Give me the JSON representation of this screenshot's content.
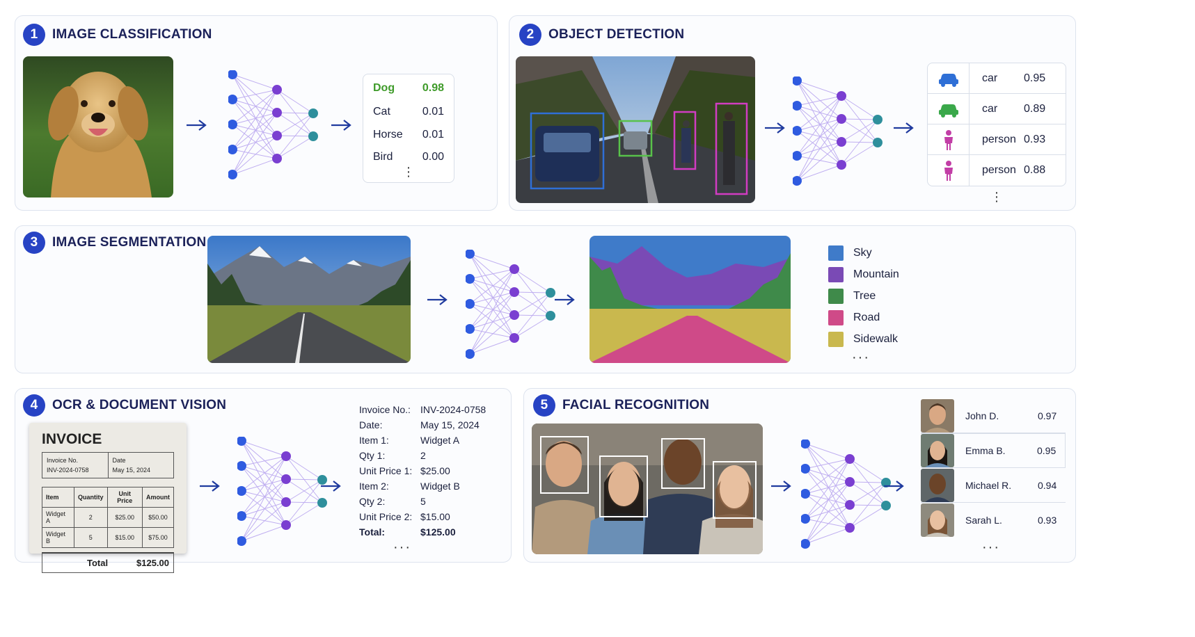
{
  "colors": {
    "accent": "#2743c4",
    "title": "#1b2159",
    "node_blue": "#2f5be0",
    "node_purple": "#7a3fd1",
    "node_teal": "#2e8f9c",
    "top_class": "#3f9b2a"
  },
  "panels": {
    "classification": {
      "number": "1",
      "title": "IMAGE CLASSIFICATION",
      "image_icon": "golden-retriever-photo",
      "results": [
        {
          "label": "Dog",
          "score": "0.98"
        },
        {
          "label": "Cat",
          "score": "0.01"
        },
        {
          "label": "Horse",
          "score": "0.01"
        },
        {
          "label": "Bird",
          "score": "0.00"
        }
      ],
      "more": "⋮"
    },
    "detection": {
      "number": "2",
      "title": "OBJECT DETECTION",
      "image_icon": "city-street-photo",
      "results": [
        {
          "icon": "car-icon",
          "icon_color": "#2f6fd6",
          "label": "car",
          "score": "0.95"
        },
        {
          "icon": "car-icon",
          "icon_color": "#3aa84a",
          "label": "car",
          "score": "0.89"
        },
        {
          "icon": "person-icon",
          "icon_color": "#c23ea6",
          "label": "person",
          "score": "0.93"
        },
        {
          "icon": "person-icon",
          "icon_color": "#c23ea6",
          "label": "person",
          "score": "0.88"
        }
      ],
      "more": "⋮"
    },
    "segmentation": {
      "number": "3",
      "title": "IMAGE SEGMENTATION",
      "image_icon": "mountain-road-photo",
      "legend": [
        {
          "label": "Sky",
          "color": "#3f7bc9"
        },
        {
          "label": "Mountain",
          "color": "#7a4ab5"
        },
        {
          "label": "Tree",
          "color": "#3f8a4a"
        },
        {
          "label": "Road",
          "color": "#cf4a88"
        },
        {
          "label": "Sidewalk",
          "color": "#c9b84e"
        }
      ],
      "more": "···"
    },
    "ocr": {
      "number": "4",
      "title": "OCR & DOCUMENT VISION",
      "invoice": {
        "title": "INVOICE",
        "no_label": "Invoice No.",
        "no_value": "INV-2024-0758",
        "date_label": "Date",
        "date_value": "May 15, 2024",
        "headers": [
          "Item",
          "Quantity",
          "Unit Price",
          "Amount"
        ],
        "rows": [
          [
            "Widget A",
            "2",
            "$25.00",
            "$50.00"
          ],
          [
            "Widget B",
            "5",
            "$15.00",
            "$75.00"
          ]
        ],
        "total_label": "Total",
        "total_value": "$125.00"
      },
      "fields": [
        {
          "key": "Invoice No.:",
          "value": "INV-2024-0758"
        },
        {
          "key": "Date:",
          "value": "May 15, 2024"
        },
        {
          "key": "Item 1:",
          "value": "Widget A"
        },
        {
          "key": "Qty 1:",
          "value": "2"
        },
        {
          "key": "Unit Price 1:",
          "value": "$25.00"
        },
        {
          "key": "Item 2:",
          "value": "Widget B"
        },
        {
          "key": "Qty 2:",
          "value": "5"
        },
        {
          "key": "Unit Price 2:",
          "value": "$15.00"
        },
        {
          "key": "Total:",
          "value": "$125.00"
        }
      ],
      "more": "···"
    },
    "facial": {
      "number": "5",
      "title": "FACIAL RECOGNITION",
      "image_icon": "group-portrait-photo",
      "results": [
        {
          "name": "John D.",
          "score": "0.97"
        },
        {
          "name": "Emma B.",
          "score": "0.95"
        },
        {
          "name": "Michael R.",
          "score": "0.94"
        },
        {
          "name": "Sarah L.",
          "score": "0.93"
        }
      ],
      "more": "···"
    }
  }
}
